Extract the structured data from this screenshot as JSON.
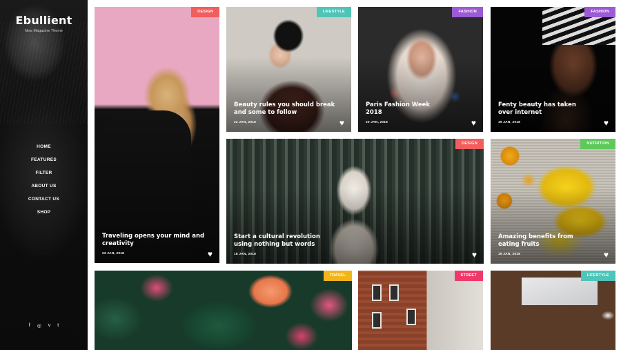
{
  "sidebar": {
    "logo": "Ebullient",
    "tagline": "New Magazine Theme",
    "nav": [
      "HOME",
      "FEATURES",
      "FILTER",
      "ABOUT US",
      "CONTACT US",
      "SHOP"
    ],
    "social_icons": [
      "facebook-icon",
      "instagram-icon",
      "vimeo-icon",
      "twitter-icon"
    ],
    "social_glyphs": [
      "f",
      "◎",
      "v",
      "t"
    ]
  },
  "colors": {
    "design": "#f25d5d",
    "lifestyle": "#4fc4b8",
    "fashion": "#9c5ad6",
    "nutrition": "#5ec85a",
    "travel": "#f1b51c",
    "street": "#f0396b"
  },
  "cards": [
    {
      "category": "DESIGN",
      "title": "Traveling opens your mind and creativity",
      "date": "23 JAN, 2018"
    },
    {
      "category": "LIFESTYLE",
      "title": "Beauty rules you should break and some to follow",
      "date": "22 JAN, 2018"
    },
    {
      "category": "FASHION",
      "title": "Paris Fashion Week 2018",
      "date": "20 JAN, 2018"
    },
    {
      "category": "FASHION",
      "title": "Fenty beauty has taken over internet",
      "date": "19 JAN, 2018"
    },
    {
      "category": "DESIGN",
      "title": "Start a cultural revolution using nothing but words",
      "date": "18 JAN, 2018"
    },
    {
      "category": "NUTRITION",
      "title": "Amazing benefits from eating fruits",
      "date": "16 JAN, 2018"
    },
    {
      "category": "TRAVEL"
    },
    {
      "category": "STREET"
    },
    {
      "category": "LIFESTYLE"
    }
  ],
  "heart_glyph": "♥"
}
